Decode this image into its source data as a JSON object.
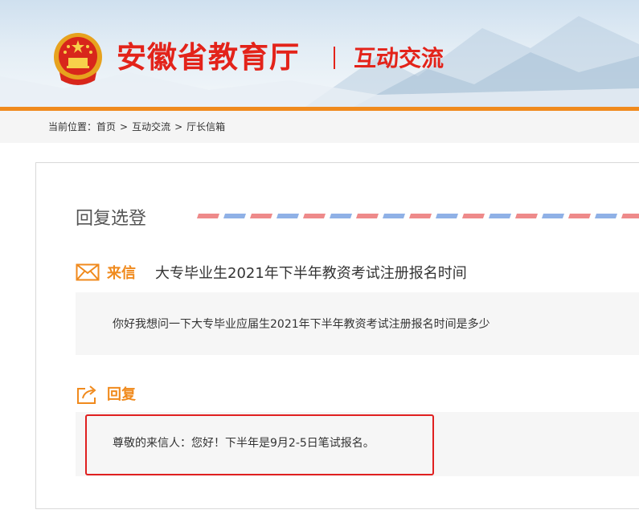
{
  "header": {
    "site_title": "安徽省教育厅",
    "section_title": "互动交流",
    "colors": {
      "brand_red": "#e3231a",
      "accent_orange": "#f08a1d"
    }
  },
  "breadcrumb": {
    "prefix": "当前位置：",
    "items": [
      "首页",
      "互动交流",
      "厅长信箱"
    ],
    "separator": ">"
  },
  "main": {
    "heading": "回复选登",
    "letter": {
      "icon": "envelope-icon",
      "label": "来信",
      "subject": "大专毕业生2021年下半年教资考试注册报名时间",
      "body": "你好我想问一下大专毕业应届生2021年下半年教资考试注册报名时间是多少"
    },
    "reply": {
      "icon": "share-reply-icon",
      "label": "回复",
      "body": "尊敬的来信人：您好！下半年是9月2-5日笔试报名。"
    }
  }
}
